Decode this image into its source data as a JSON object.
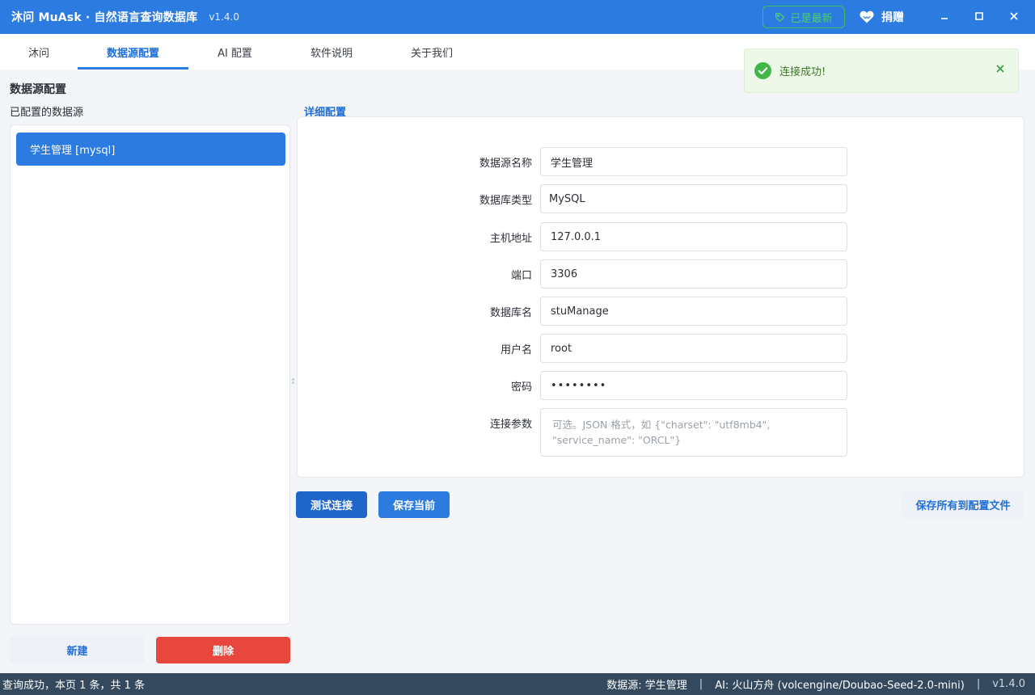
{
  "titlebar": {
    "title": "沐问 MuAsk · 自然语言查询数据库",
    "version": "v1.4.0",
    "latest_badge": "已是最新",
    "donate_label": "捐赠",
    "icons": [
      "tag-icon",
      "heart-hands-icon",
      "minimize-icon",
      "maximize-icon",
      "close-icon"
    ]
  },
  "tabs": [
    {
      "label": "沐问",
      "active": false
    },
    {
      "label": "数据源配置",
      "active": true
    },
    {
      "label": "AI 配置",
      "active": false
    },
    {
      "label": "软件说明",
      "active": false
    },
    {
      "label": "关于我们",
      "active": false
    }
  ],
  "toast": {
    "message": "连接成功!",
    "type": "success"
  },
  "page": {
    "section_title": "数据源配置",
    "list_label": "已配置的数据源",
    "detail_label": "详细配置"
  },
  "datasources": [
    {
      "label": "学生管理 [mysql]",
      "selected": true
    }
  ],
  "form": {
    "name_label": "数据源名称",
    "name_value": "学生管理",
    "type_label": "数据库类型",
    "type_value": "MySQL",
    "host_label": "主机地址",
    "host_value": "127.0.0.1",
    "port_label": "端口",
    "port_value": "3306",
    "db_label": "数据库名",
    "db_value": "stuManage",
    "user_label": "用户名",
    "user_value": "root",
    "password_label": "密码",
    "password_value": "••••••••",
    "params_label": "连接参数",
    "params_placeholder": "可选。JSON 格式，如 {\"charset\": \"utf8mb4\", \"service_name\": \"ORCL\"}"
  },
  "buttons": {
    "new": "新建",
    "delete": "删除",
    "test": "测试连接",
    "save": "保存当前",
    "save_all": "保存所有到配置文件"
  },
  "status": {
    "left": "查询成功，本页 1 条，共 1 条",
    "datasource": "数据源: 学生管理",
    "ai": "AI: 火山方舟 (volcengine/Doubao-Seed-2.0-mini)",
    "version": "v1.4.0",
    "separator": "|"
  },
  "colors": {
    "brand": "#2b7be0",
    "success": "#3fbf5a",
    "danger": "#e8473d",
    "statusbar": "#34495e"
  }
}
